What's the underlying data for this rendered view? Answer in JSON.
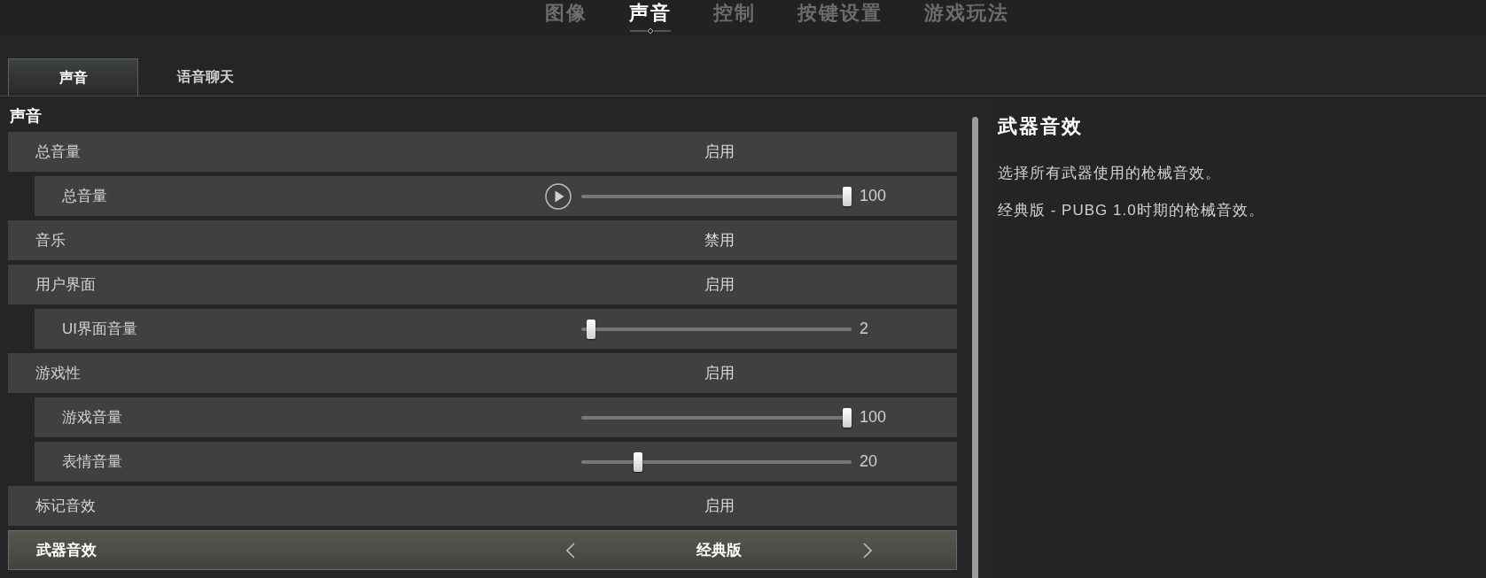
{
  "top_tabs": [
    {
      "label": "图像",
      "selected": false
    },
    {
      "label": "声音",
      "selected": true
    },
    {
      "label": "控制",
      "selected": false
    },
    {
      "label": "按键设置",
      "selected": false
    },
    {
      "label": "游戏玩法",
      "selected": false
    }
  ],
  "sub_tabs": [
    {
      "label": "声音",
      "selected": true
    },
    {
      "label": "语音聊天",
      "selected": false
    }
  ],
  "section": {
    "title": "声音",
    "rows": [
      {
        "kind": "toggle",
        "label": "总音量",
        "value": "启用",
        "selected": false,
        "children": [
          {
            "kind": "slider",
            "label": "总音量",
            "level": 1,
            "reading": "100",
            "preview": true,
            "selected": false
          }
        ]
      },
      {
        "kind": "toggle",
        "label": "音乐",
        "value": "禁用",
        "selected": false
      },
      {
        "kind": "toggle",
        "label": "用户界面",
        "value": "启用",
        "selected": false,
        "children": [
          {
            "kind": "slider",
            "label": "UI界面音量",
            "level": 0.02,
            "reading": "2",
            "preview": false,
            "selected": false
          }
        ]
      },
      {
        "kind": "toggle",
        "label": "游戏性",
        "value": "启用",
        "selected": false,
        "children": [
          {
            "kind": "slider",
            "label": "游戏音量",
            "level": 1,
            "reading": "100",
            "preview": false,
            "selected": false
          },
          {
            "kind": "slider",
            "label": "表情音量",
            "level": 0.2,
            "reading": "20",
            "preview": false,
            "selected": false
          }
        ]
      },
      {
        "kind": "toggle",
        "label": "标记音效",
        "value": "启用",
        "selected": false
      },
      {
        "kind": "selector",
        "label": "武器音效",
        "value": "经典版",
        "selected": true
      }
    ]
  },
  "details": {
    "title": "武器音效",
    "paragraphs": [
      "选择所有武器使用的枪械音效。",
      "经典版 - PUBG 1.0时期的枪械音效。"
    ]
  }
}
